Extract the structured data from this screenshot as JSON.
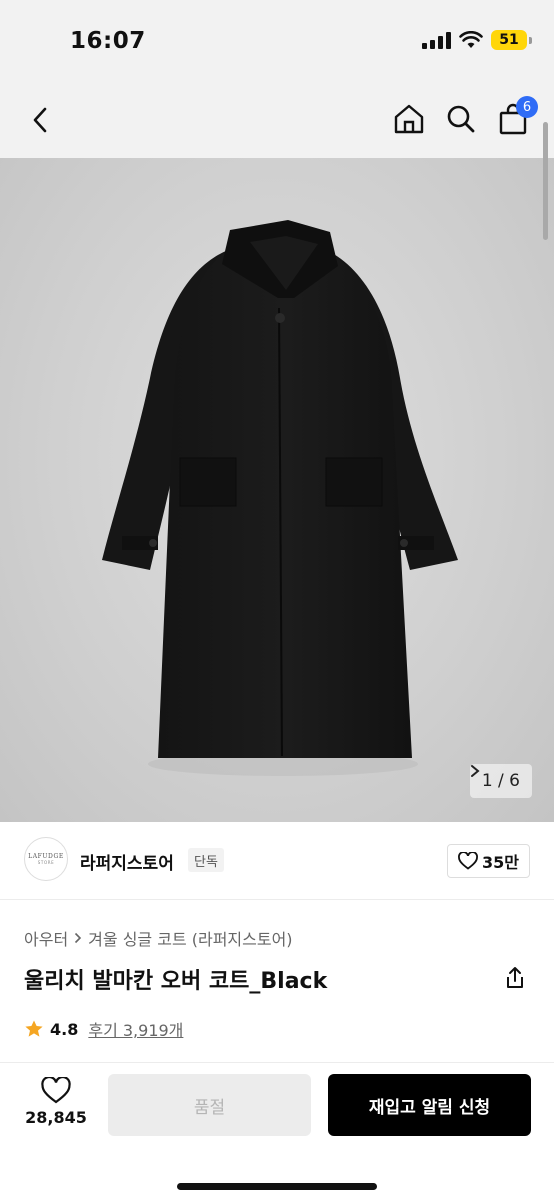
{
  "status_bar": {
    "time": "16:07",
    "battery": "51"
  },
  "nav": {
    "cart_count": "6"
  },
  "gallery": {
    "current": "1 / 6"
  },
  "store": {
    "logo_text": "LAFUDGE",
    "logo_subtext": "STORE",
    "name": "라퍼지스토어",
    "tag": "단독",
    "likes": "35만"
  },
  "product": {
    "breadcrumb_category": "아우터",
    "breadcrumb_sub": "겨울 싱글 코트 (라퍼지스토어)",
    "title": "울리치 발마칸 오버 코트_Black",
    "rating": "4.8",
    "reviews": "후기 3,919개"
  },
  "bottom_bar": {
    "wish_count": "28,845",
    "soldout_label": "품절",
    "restock_label": "재입고 알림 신청"
  },
  "colors": {
    "accent_badge": "#2f6cf6",
    "star": "#f5a623",
    "battery": "#ffd60a"
  }
}
